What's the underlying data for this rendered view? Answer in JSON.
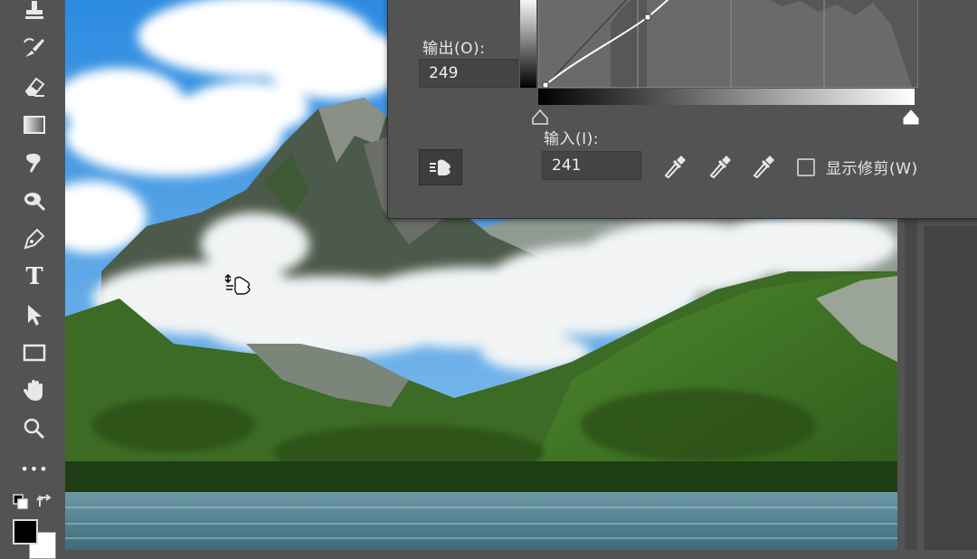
{
  "toolbar": {
    "tools": [
      {
        "name": "clone-stamp-icon"
      },
      {
        "name": "history-brush-icon"
      },
      {
        "name": "eraser-icon"
      },
      {
        "name": "gradient-icon"
      },
      {
        "name": "blur-icon"
      },
      {
        "name": "dodge-icon"
      },
      {
        "name": "pen-icon"
      },
      {
        "name": "type-icon",
        "glyph": "T"
      },
      {
        "name": "path-selection-icon"
      },
      {
        "name": "rectangle-icon"
      },
      {
        "name": "hand-icon"
      },
      {
        "name": "zoom-icon"
      },
      {
        "name": "more-tools-icon",
        "glyph": "•••"
      }
    ],
    "foreground_color": "#000000",
    "background_color": "#ffffff"
  },
  "curves": {
    "output_label": "输出(O):",
    "output_value": "249",
    "input_label": "输入(I):",
    "input_value": "241",
    "show_clipping_label": "显示修剪(W)",
    "show_clipping_checked": false,
    "eyedroppers": [
      "black-point-eyedropper-icon",
      "gray-point-eyedropper-icon",
      "white-point-eyedropper-icon"
    ],
    "curve_color": "#ffffff",
    "graph_background": "#6a6a6a"
  },
  "canvas": {
    "subject": "mountain-lake-photo"
  }
}
